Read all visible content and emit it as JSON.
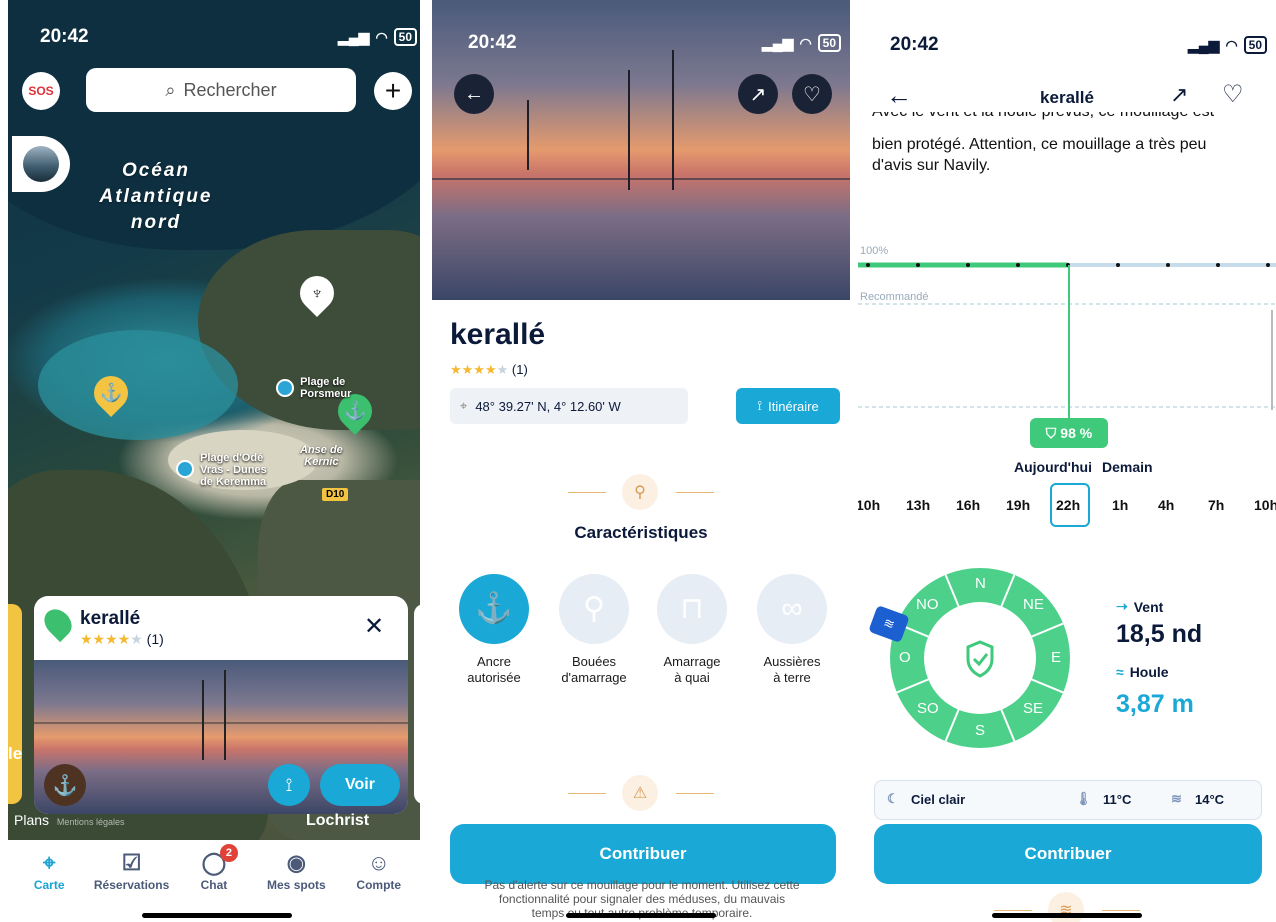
{
  "status": {
    "time": "20:42",
    "battery": "50",
    "signal_icon": "signal-icon",
    "wifi_icon": "wifi-icon"
  },
  "screen1": {
    "sos": "SOS",
    "search_placeholder": "Rechercher",
    "ocean_label": [
      "Océan",
      "Atlantique",
      "nord"
    ],
    "places": {
      "porsmeur": [
        "Plage de",
        "Porsmeur"
      ],
      "anse": [
        "Anse de",
        "Kernic"
      ],
      "ode": [
        "Plage d'Odé",
        "Vras - Dunes",
        "de Keremma"
      ],
      "road": "D10",
      "lochrist": "Lochrist",
      "left_fragment": "le"
    },
    "card": {
      "title": "kerallé",
      "reviews": "(1)",
      "rating": 4,
      "cta": "Voir"
    },
    "attribution": {
      "brand": "Plans",
      "legal": "Mentions légales"
    },
    "tabs": [
      {
        "label": "Carte",
        "icon": "map-icon",
        "active": true
      },
      {
        "label": "Réservations",
        "icon": "calendar-check-icon",
        "active": false
      },
      {
        "label": "Chat",
        "icon": "chat-bubble-icon",
        "active": false,
        "badge": "2"
      },
      {
        "label": "Mes spots",
        "icon": "location-pin-icon",
        "active": false
      },
      {
        "label": "Compte",
        "icon": "user-icon",
        "active": false
      }
    ]
  },
  "screen2": {
    "title": "kerallé",
    "reviews": "(1)",
    "rating": 4,
    "coords": "48° 39.27' N, 4° 12.60' W",
    "itinerary": "Itinéraire",
    "section_title": "Caractéristiques",
    "features": [
      {
        "label": [
          "Ancre",
          "autorisée"
        ],
        "icon": "anchor-icon",
        "active": true
      },
      {
        "label": [
          "Bouées",
          "d'amarrage"
        ],
        "icon": "buoy-icon",
        "active": false
      },
      {
        "label": [
          "Amarrage",
          "à quai"
        ],
        "icon": "dock-icon",
        "active": false
      },
      {
        "label": [
          "Aussières",
          "à terre"
        ],
        "icon": "rope-icon",
        "active": false
      }
    ],
    "contribute": "Contribuer",
    "footer_text": [
      "Pas d'alerte sur ce mouillage pour le moment. Utilisez cette",
      "fonctionnalité pour signaler des méduses, du mauvais",
      "temps ou tout autre problème temporaire."
    ]
  },
  "screen3": {
    "title": "kerallé",
    "intro_cut": "Avec le vent et la houle prévus, ce mouillage est",
    "intro": [
      "bien protégé. Attention, ce mouillage a très peu",
      "d'avis sur Navily."
    ],
    "chart_100": "100%",
    "chart_recommended": "Recommandé",
    "score": "98 %",
    "day_today": "Aujourd'hui",
    "day_tomorrow": "Demain",
    "hours": [
      "10h",
      "13h",
      "16h",
      "19h",
      "22h",
      "1h",
      "4h",
      "7h",
      "10h"
    ],
    "selected_hour": "22h",
    "compass": [
      "N",
      "NE",
      "E",
      "SE",
      "S",
      "SO",
      "O",
      "NO"
    ],
    "wind_label": "Vent",
    "wind_value": "18,5 nd",
    "swell_label": "Houle",
    "swell_value": "3,87 m",
    "sky": "Ciel clair",
    "air_temp": "11°C",
    "water_temp": "14°C",
    "contribute": "Contribuer"
  },
  "colors": {
    "accent": "#1aa8d6",
    "green": "#3fc97a",
    "navy": "#0c1a3a",
    "star": "#f5b82e"
  }
}
